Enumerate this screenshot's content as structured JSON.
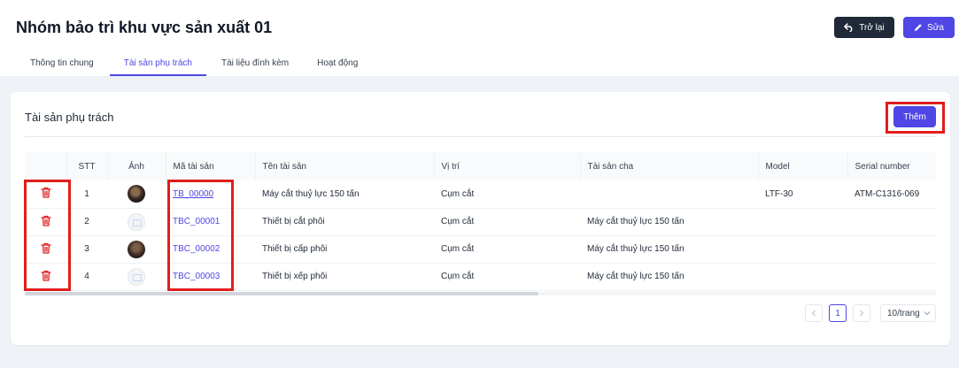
{
  "header": {
    "title": "Nhóm bảo trì khu vực sản xuất 01",
    "back_label": "Trở lại",
    "edit_label": "Sửa"
  },
  "tabs": [
    {
      "label": "Thông tin chung",
      "active": false
    },
    {
      "label": "Tài sản phụ trách",
      "active": true
    },
    {
      "label": "Tài liệu đính kèm",
      "active": false
    },
    {
      "label": "Hoạt động",
      "active": false
    }
  ],
  "section": {
    "title": "Tài sản phụ trách",
    "add_label": "Thêm"
  },
  "table": {
    "columns": [
      "STT",
      "Ảnh",
      "Mã tài sản",
      "Tên tài sản",
      "Vị trí",
      "Tài sản cha",
      "Model",
      "Serial number"
    ],
    "rows": [
      {
        "stt": "1",
        "image": "photo",
        "code": "TB_00000",
        "name": "Máy cắt thuỷ lực 150 tấn",
        "location": "Cụm cắt",
        "parent": "",
        "model": "LTF-30",
        "serial": "ATM-C1316-069"
      },
      {
        "stt": "2",
        "image": "placeholder",
        "code": "TBC_00001",
        "name": "Thiết bị cắt phôi",
        "location": "Cụm cắt",
        "parent": "Máy cắt thuỷ lực 150 tấn",
        "model": "",
        "serial": ""
      },
      {
        "stt": "3",
        "image": "photo",
        "code": "TBC_00002",
        "name": "Thiết bị cấp phôi",
        "location": "Cụm cắt",
        "parent": "Máy cắt thuỷ lực 150 tấn",
        "model": "",
        "serial": ""
      },
      {
        "stt": "4",
        "image": "placeholder",
        "code": "TBC_00003",
        "name": "Thiết bị xếp phôi",
        "location": "Cụm cắt",
        "parent": "Máy cắt thuỷ lực 150 tấn",
        "model": "",
        "serial": ""
      }
    ]
  },
  "pagination": {
    "current_page": "1",
    "page_size": "10/trang"
  },
  "colors": {
    "primary": "#4f46e5",
    "dark": "#1f2937",
    "danger": "#e11d1d",
    "highlight": "#e11d1d"
  }
}
